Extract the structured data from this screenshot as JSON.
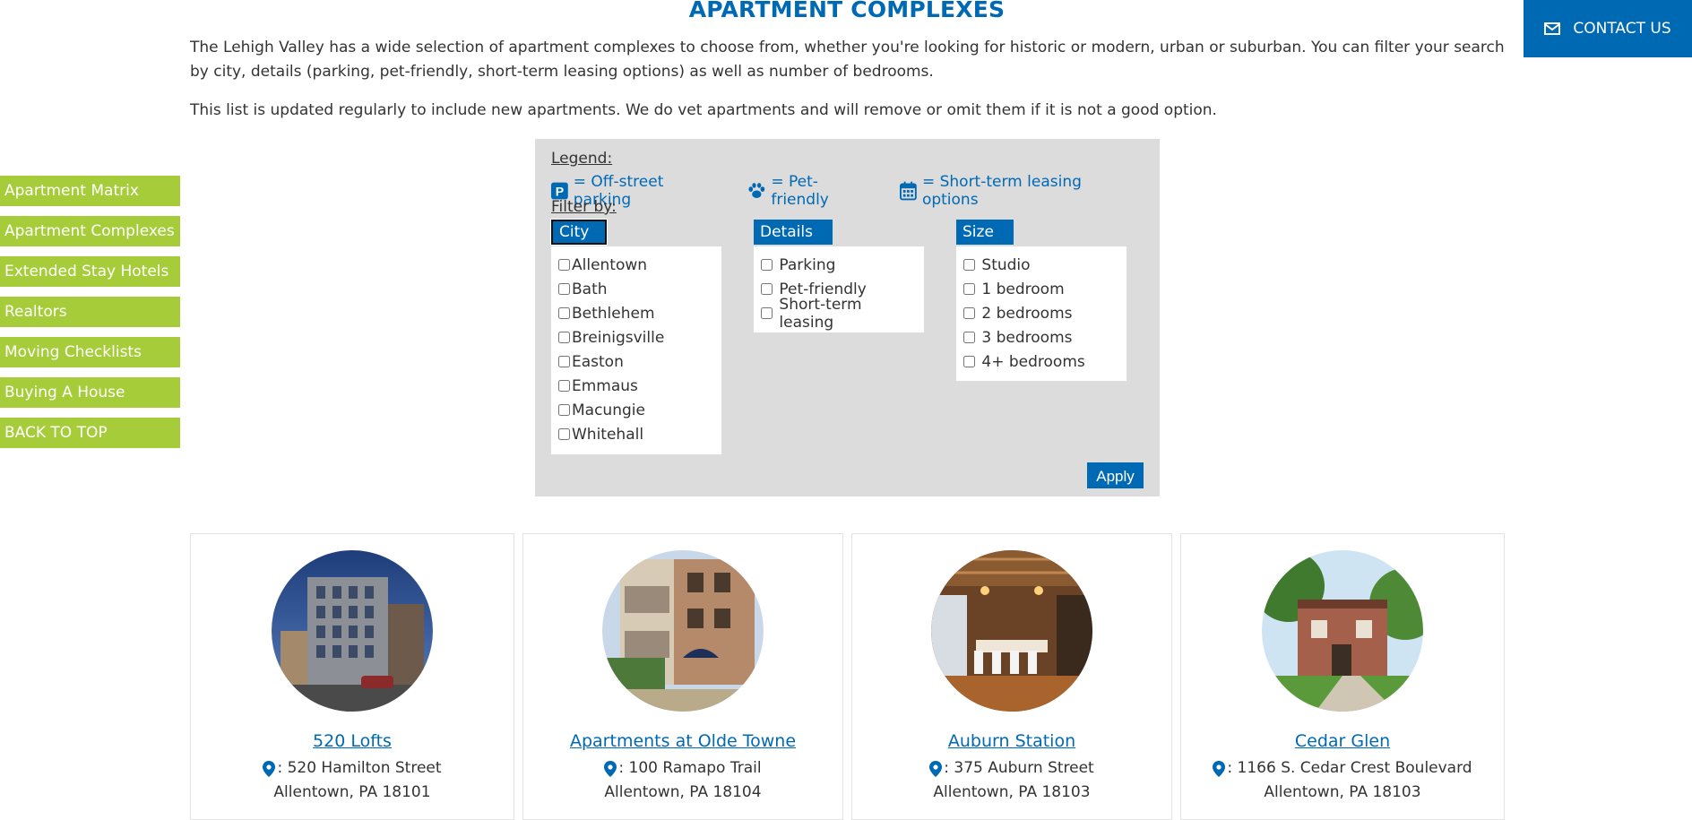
{
  "page": {
    "title": "APARTMENT COMPLEXES",
    "intro": "The Lehigh Valley has a wide selection of apartment complexes to choose from, whether you're looking for historic or modern, urban or suburban. You can filter your search by city, details (parking, pet-friendly, short-term leasing options) as well as number of bedrooms.",
    "intro2": "This list is updated regularly to include new apartments. We do vet apartments and will remove or omit them if it is not a good option."
  },
  "contact": {
    "label": "CONTACT US",
    "icon": "envelope-icon"
  },
  "sidebar": {
    "items": [
      {
        "label": "Apartment Matrix"
      },
      {
        "label": "Apartment Complexes"
      },
      {
        "label": "Extended Stay Hotels"
      },
      {
        "label": "Realtors"
      },
      {
        "label": "Moving Checklists"
      },
      {
        "label": "Buying A House"
      },
      {
        "label": "BACK TO TOP"
      }
    ]
  },
  "legend": {
    "title": "Legend:",
    "parking": "= Off-street parking",
    "pet": "= Pet-friendly",
    "short_term": "= Short-term leasing options"
  },
  "filter": {
    "title": "Filter by:",
    "city_label": "City",
    "details_label": "Details",
    "size_label": "Size",
    "cities": [
      "Allentown",
      "Bath",
      "Bethlehem",
      "Breinigsville",
      "Easton",
      "Emmaus",
      "Macungie",
      "Whitehall"
    ],
    "details": [
      "Parking",
      "Pet-friendly",
      "Short-term leasing"
    ],
    "sizes": [
      "Studio",
      "1 bedroom",
      "2 bedrooms",
      "3 bedrooms",
      "4+ bedrooms"
    ],
    "apply_label": "Apply"
  },
  "listings": [
    {
      "name": "520 Lofts",
      "address": ": 520 Hamilton Street",
      "city": "Allentown, PA 18101"
    },
    {
      "name": "Apartments at Olde Towne",
      "address": ": 100 Ramapo Trail",
      "city": "Allentown, PA 18104"
    },
    {
      "name": "Auburn Station",
      "address": ": 375 Auburn Street",
      "city": "Allentown, PA 18103"
    },
    {
      "name": "Cedar Glen",
      "address": ": 1166 S. Cedar Crest Boulevard",
      "city": "Allentown, PA 18103"
    }
  ],
  "colors": {
    "brand_blue": "#0069b4",
    "side_green": "#a6cd39",
    "filter_bg": "#dcdcdc"
  }
}
